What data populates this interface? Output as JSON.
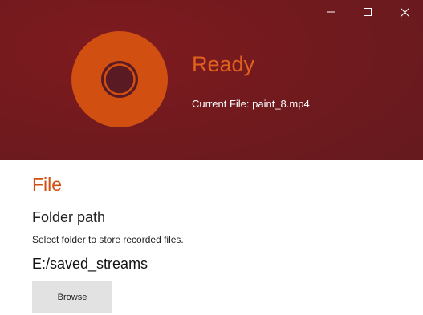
{
  "window": {
    "controls": {
      "minimize_icon": "minimize-icon",
      "maximize_icon": "maximize-icon",
      "close_icon": "close-icon"
    }
  },
  "header": {
    "record_icon": "record-icon",
    "status": "Ready",
    "current_file": "Current File: paint_8.mp4"
  },
  "file_section": {
    "title": "File",
    "folder_path_heading": "Folder path",
    "description": "Select folder to store recorded files.",
    "path_value": "E:/saved_streams",
    "browse_label": "Browse"
  },
  "colors": {
    "header_background": "#6f1a1e",
    "accent_orange": "#d14f10",
    "status_text": "#e0621c",
    "record_inner": "#5a1a24",
    "button_background": "#e2e2e2"
  }
}
